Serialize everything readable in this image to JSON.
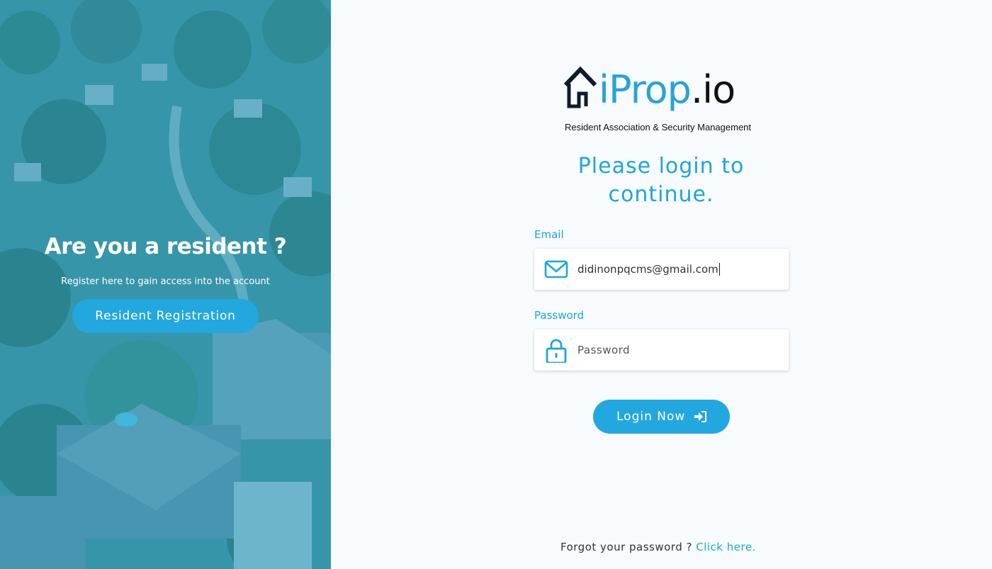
{
  "left": {
    "title": "Are you a resident ?",
    "subtitle": "Register here to gain access into the account",
    "register_button": "Resident Registration"
  },
  "logo": {
    "i": "i",
    "prop": "Prop",
    "io": ".io",
    "tagline": "Resident Association & Security Management"
  },
  "login": {
    "heading": "Please login to continue.",
    "email_label": "Email",
    "email_value": "didinonpqcms@gmail.com",
    "password_label": "Password",
    "password_placeholder": "Password",
    "login_button": "Login Now"
  },
  "footer": {
    "forgot_text": "Forgot your password ?",
    "forgot_link": "Click here."
  },
  "colors": {
    "accent": "#23a7df",
    "heading": "#1ea6d8",
    "overlay": "#3a8fa6"
  },
  "icons": [
    "house-logo-icon",
    "envelope-icon",
    "lock-icon",
    "sign-in-icon"
  ]
}
